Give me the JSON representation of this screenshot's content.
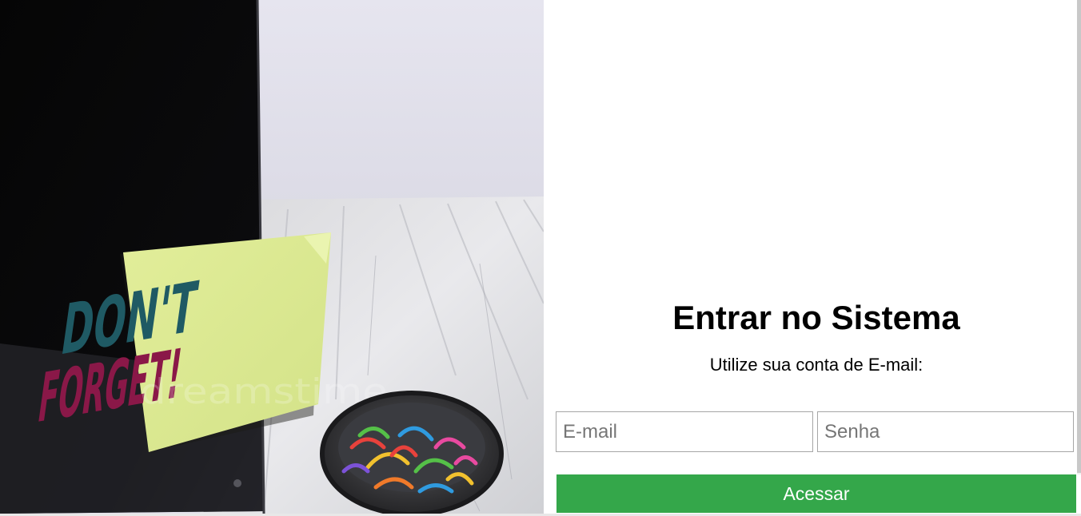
{
  "photo": {
    "note_line1": "DON'T",
    "note_line2": "FORGET!",
    "watermark": "dreamstime"
  },
  "login": {
    "title": "Entrar no Sistema",
    "subtitle": "Utilize sua conta de E-mail:",
    "email_placeholder": "E-mail",
    "email_value": "",
    "password_placeholder": "Senha",
    "password_value": "",
    "submit_label": "Acessar"
  },
  "colors": {
    "button_bg": "#34a74a",
    "button_text": "#ffffff",
    "field_border": "#a6a6a6",
    "title_text": "#000000"
  }
}
